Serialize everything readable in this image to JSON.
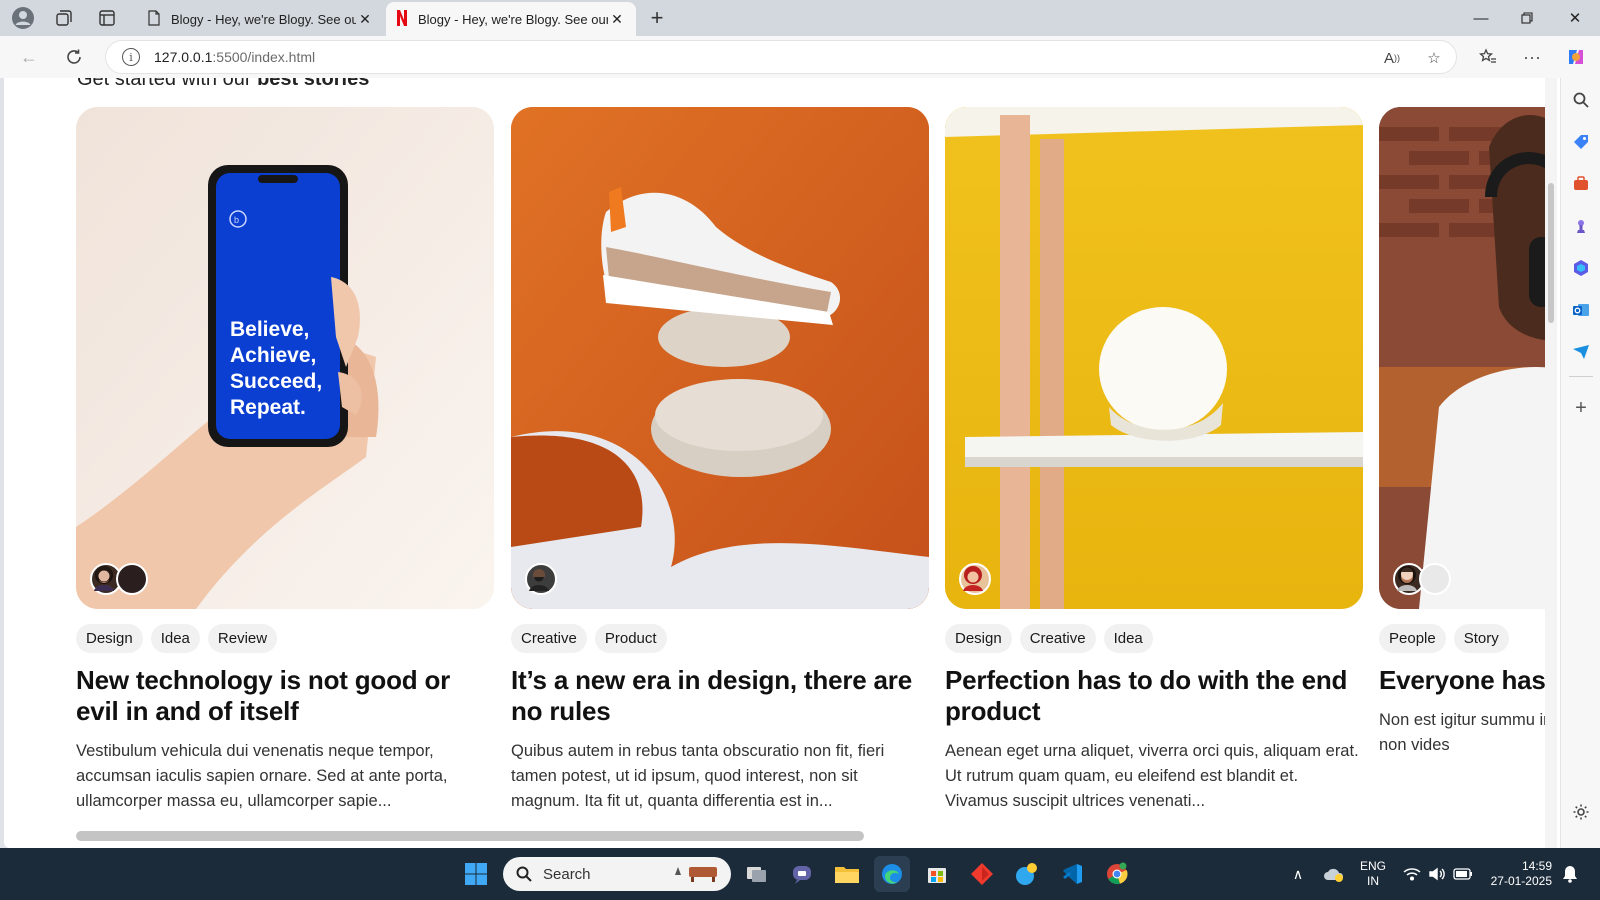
{
  "browser": {
    "tabs": [
      {
        "title": "Blogy - Hey, we're Blogy. See our",
        "active": false
      },
      {
        "title": "Blogy - Hey, we're Blogy. See our",
        "active": true
      }
    ],
    "url_host": "127.0.0.1",
    "url_path": ":5500/index.html"
  },
  "page": {
    "heading_prefix": "Get started with our",
    "heading_bold": "best stories",
    "cards": [
      {
        "tags": [
          "Design",
          "Idea",
          "Review"
        ],
        "title": "New technology is not good or evil in and of itself",
        "excerpt": "Vestibulum vehicula dui venenatis neque tempor, accumsan iaculis sapien ornare. Sed at ante porta, ullamcorper massa eu, ullamcorper sapie...",
        "image_text": "Believe, Achieve, Succeed, Repeat."
      },
      {
        "tags": [
          "Creative",
          "Product"
        ],
        "title": "It’s a new era in design, there are no rules",
        "excerpt": "Quibus autem in rebus tanta obscuratio non fit, fieri tamen potest, ut id ipsum, quod interest, non sit magnum. Ita fit ut, quanta differentia est in..."
      },
      {
        "tags": [
          "Design",
          "Creative",
          "Idea"
        ],
        "title": "Perfection has to do with the end product",
        "excerpt": "Aenean eget urna aliquet, viverra orci quis, aliquam erat. Ut rutrum quam quam, eu eleifend est blandit et. Vivamus suscipit ultrices venenati..."
      },
      {
        "tags": [
          "People",
          "Story"
        ],
        "title": "Everyone has story",
        "excerpt": "Non est igitur summu inter haec tantam mu interiectam non vides"
      }
    ]
  },
  "taskbar": {
    "search_placeholder": "Search",
    "lang_line1": "ENG",
    "lang_line2": "IN",
    "time": "14:59",
    "date": "27-01-2025"
  },
  "colors": {
    "accent_blue": "#0a5ad6",
    "card2_orange": "#d8611f",
    "card3_yellow": "#f2c019",
    "taskbar_bg": "#1c2b3a"
  }
}
